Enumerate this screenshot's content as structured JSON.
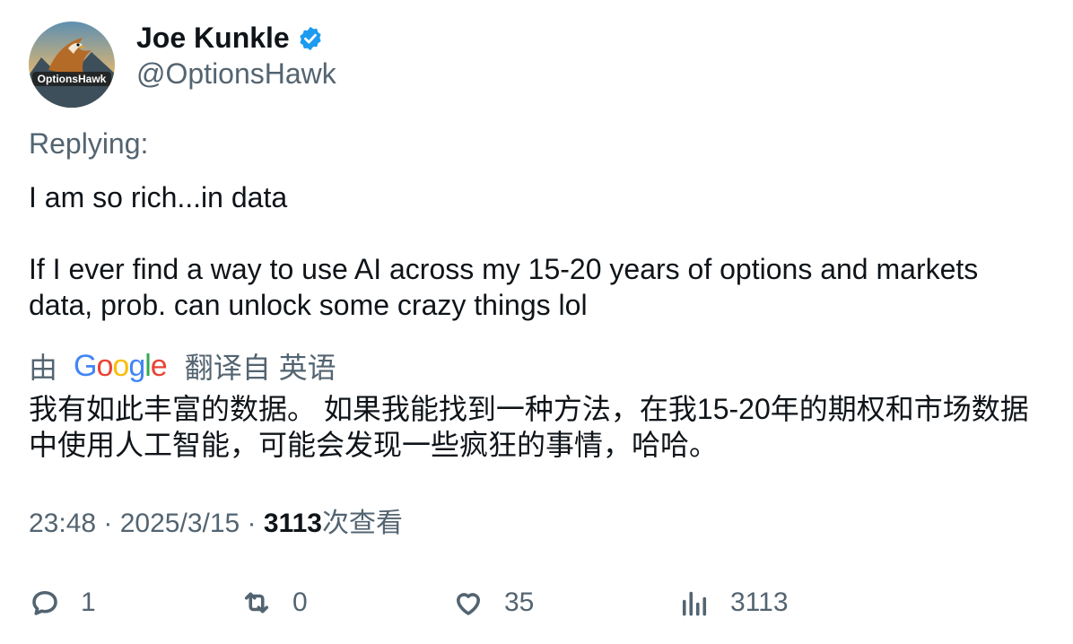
{
  "author": {
    "display_name": "Joe Kunkle",
    "handle": "@OptionsHawk",
    "avatar_text": "OptionsHawk",
    "verified_color": "#1d9bf0"
  },
  "tweet": {
    "replying_label": "Replying:",
    "text": "I am so rich...in data\n\nIf I ever find a way to use AI across my 15-20 years of options and markets data, prob. can unlock some crazy things lol"
  },
  "translation": {
    "prefix": "由",
    "provider": "Google",
    "suffix": "翻译自 英语",
    "text": "我有如此丰富的数据。 如果我能找到一种方法，在我15-20年的期权和市场数据中使用人工智能，可能会发现一些疯狂的事情，哈哈。"
  },
  "meta": {
    "time": "23:48",
    "separator": " · ",
    "date": "2025/3/15",
    "views_count": "3113",
    "views_label": "次查看"
  },
  "actions": {
    "reply": {
      "icon": "reply-icon",
      "count": "1"
    },
    "retweet": {
      "icon": "retweet-icon",
      "count": "0"
    },
    "like": {
      "icon": "heart-icon",
      "count": "35"
    },
    "views": {
      "icon": "analytics-icon",
      "count": "3113"
    }
  },
  "colors": {
    "text_primary": "#0f1419",
    "text_secondary": "#536471",
    "google_blue": "#4285f4",
    "google_red": "#ea4335",
    "google_yellow": "#fbbc05",
    "google_green": "#34a853"
  }
}
